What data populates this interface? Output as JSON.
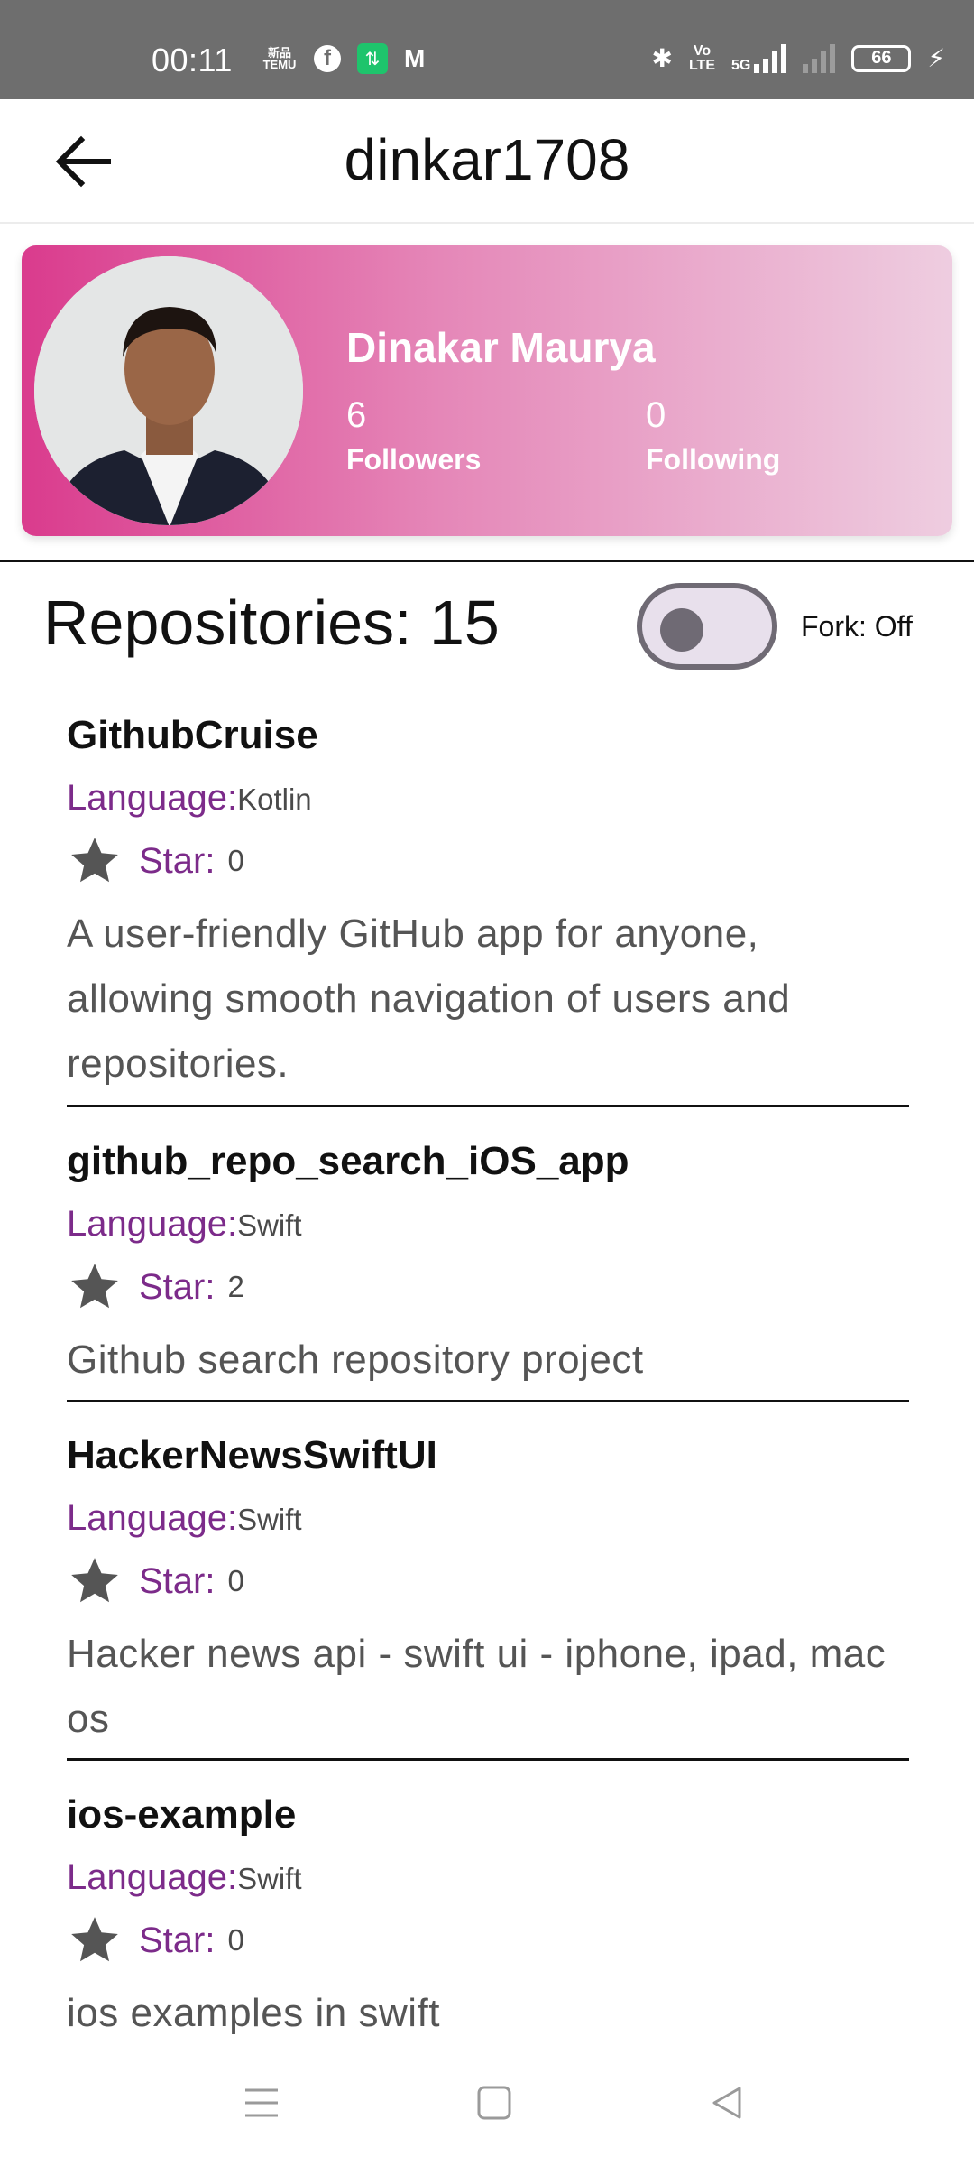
{
  "status_bar": {
    "time": "00:11",
    "temu_label_1": "新品",
    "temu_label_2": "TEMU",
    "fb_glyph": "f",
    "green_glyph": "⇅",
    "gmail_glyph": "M",
    "bt_glyph": "✱",
    "volte_1": "Vo",
    "volte_2": "LTE",
    "net": "5G",
    "battery": "66",
    "bolt": "⚡"
  },
  "app_bar": {
    "title": "dinkar1708",
    "back_icon": "arrow-back-icon"
  },
  "profile": {
    "name": "Dinakar Maurya",
    "followers_count": "6",
    "followers_label": "Followers",
    "following_count": "0",
    "following_label": "Following",
    "gradient_start": "#da3b8d",
    "gradient_end": "#eecde0"
  },
  "repos_header": {
    "title": "Repositories: 15",
    "fork_label": "Fork: Off",
    "fork_enabled": false
  },
  "repos": [
    {
      "name": "GithubCruise",
      "language_label": "Language:",
      "language": "Kotlin",
      "star_label": "Star:",
      "stars": "0",
      "description": "A user-friendly GitHub app for anyone, allowing smooth navigation of users and repositories."
    },
    {
      "name": "github_repo_search_iOS_app",
      "language_label": "Language:",
      "language": "Swift",
      "star_label": "Star:",
      "stars": "2",
      "description": "Github search repository project"
    },
    {
      "name": "HackerNewsSwiftUI",
      "language_label": "Language:",
      "language": "Swift",
      "star_label": "Star:",
      "stars": "0",
      "description": "Hacker news api - swift ui - iphone, ipad, mac os"
    },
    {
      "name": "ios-example",
      "language_label": "Language:",
      "language": "Swift",
      "star_label": "Star:",
      "stars": "0",
      "description": "ios examples in swift"
    }
  ],
  "colors": {
    "accent_purple": "#7c2b8a",
    "toggle_track": "#e8e0ec",
    "toggle_outline": "#6f6a74"
  }
}
